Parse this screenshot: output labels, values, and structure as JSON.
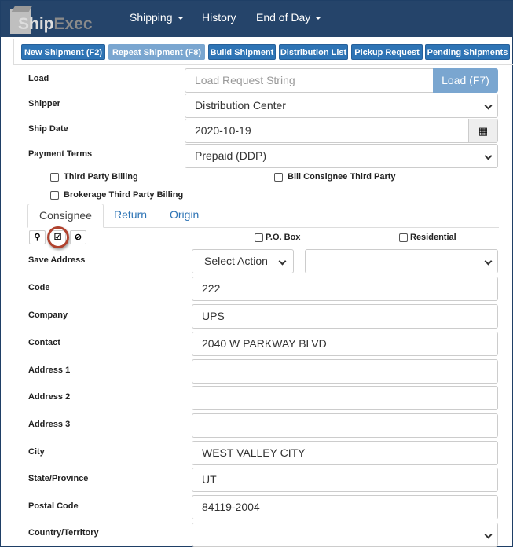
{
  "header": {
    "logo": "ShipExec",
    "nav": [
      {
        "label": "Shipping",
        "dropdown": true
      },
      {
        "label": "History",
        "dropdown": false
      },
      {
        "label": "End of Day",
        "dropdown": true
      }
    ]
  },
  "toolbar": [
    "New Shipment (F2)",
    "Repeat Shipment (F8)",
    "Build Shipment",
    "Distribution List",
    "Pickup Request",
    "Pending Shipments"
  ],
  "form": {
    "load": {
      "label": "Load",
      "placeholder": "Load Request String",
      "button": "Load (F7)"
    },
    "shipper": {
      "label": "Shipper",
      "value": "Distribution Center"
    },
    "ship_date": {
      "label": "Ship Date",
      "value": "2020-10-19"
    },
    "payment_terms": {
      "label": "Payment Terms",
      "value": "Prepaid (DDP)"
    },
    "third_party_billing": "Third Party Billing",
    "bill_consignee": "Bill Consignee Third Party",
    "brokerage": "Brokerage Third Party Billing"
  },
  "tabs": [
    "Consignee",
    "Return",
    "Origin"
  ],
  "address": {
    "po_box": "P.O. Box",
    "residential": "Residential",
    "save_address": {
      "label": "Save Address",
      "action": "Select Action",
      "value": ""
    },
    "fields": [
      {
        "label": "Code",
        "value": "222"
      },
      {
        "label": "Company",
        "value": "UPS"
      },
      {
        "label": "Contact",
        "value": "2040 W PARKWAY BLVD"
      },
      {
        "label": "Address 1",
        "value": ""
      },
      {
        "label": "Address 2",
        "value": ""
      },
      {
        "label": "Address 3",
        "value": ""
      },
      {
        "label": "City",
        "value": "WEST VALLEY CITY"
      },
      {
        "label": "State/Province",
        "value": "UT"
      },
      {
        "label": "Postal Code",
        "value": "84119-2004"
      }
    ],
    "country": {
      "label": "Country/Territory",
      "value": ""
    }
  }
}
